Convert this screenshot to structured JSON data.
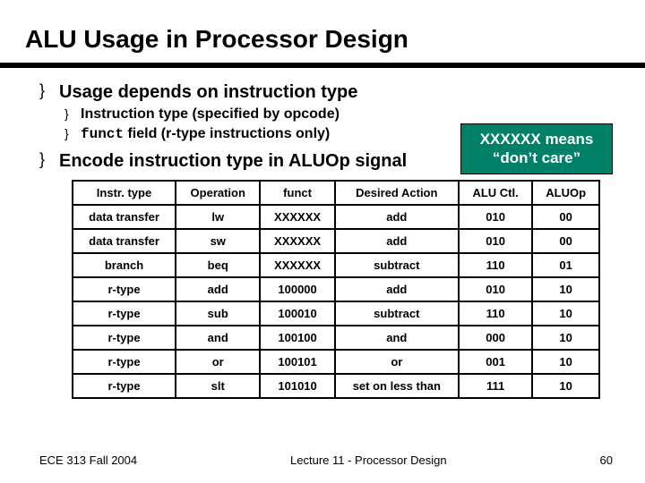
{
  "title": "ALU Usage in Processor Design",
  "bullets": [
    {
      "text": "Usage depends on instruction type",
      "sub": [
        "Instruction type (specified by opcode)",
        "<span class=\"mono\">funct</span> field (r-type instructions only)"
      ]
    },
    {
      "text": "Encode instruction type in ALUOp signal",
      "sub": []
    }
  ],
  "note": {
    "line1": "XXXXXX means",
    "line2": "“don’t care”"
  },
  "table": {
    "headers": [
      "Instr. type",
      "Operation",
      "funct",
      "Desired Action",
      "ALU Ctl.",
      "ALUOp"
    ],
    "rows": [
      [
        "data transfer",
        "lw",
        "XXXXXX",
        "add",
        "010",
        "00"
      ],
      [
        "data transfer",
        "sw",
        "XXXXXX",
        "add",
        "010",
        "00"
      ],
      [
        "branch",
        "beq",
        "XXXXXX",
        "subtract",
        "110",
        "01"
      ],
      [
        "r-type",
        "add",
        "100000",
        "add",
        "010",
        "10"
      ],
      [
        "r-type",
        "sub",
        "100010",
        "subtract",
        "110",
        "10"
      ],
      [
        "r-type",
        "and",
        "100100",
        "and",
        "000",
        "10"
      ],
      [
        "r-type",
        "or",
        "100101",
        "or",
        "001",
        "10"
      ],
      [
        "r-type",
        "slt",
        "101010",
        "set on less than",
        "111",
        "10"
      ]
    ]
  },
  "footer": {
    "left": "ECE 313 Fall 2004",
    "center": "Lecture 11 - Processor Design",
    "right": "60"
  }
}
